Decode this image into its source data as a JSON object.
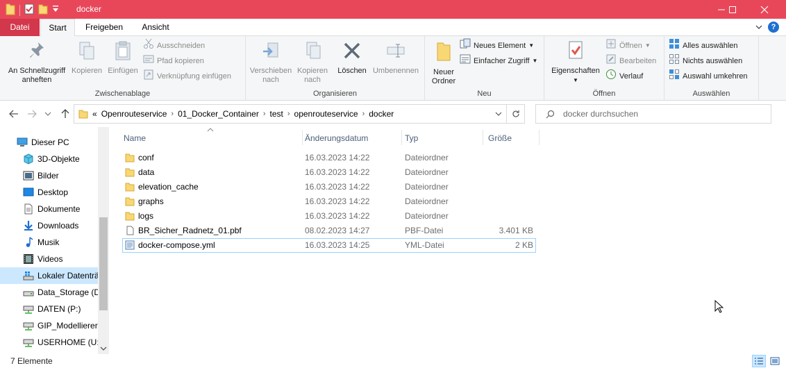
{
  "window": {
    "title": "docker",
    "accent": "#e8475a"
  },
  "tabs": {
    "file": "Datei",
    "start": "Start",
    "share": "Freigeben",
    "view": "Ansicht"
  },
  "ribbon": {
    "clipboard": {
      "label": "Zwischenablage",
      "pin": "An Schnellzugriff anheften",
      "copy": "Kopieren",
      "paste": "Einfügen",
      "cut": "Ausschneiden",
      "copy_path": "Pfad kopieren",
      "paste_shortcut": "Verknüpfung einfügen"
    },
    "organize": {
      "label": "Organisieren",
      "move_to": "Verschieben nach",
      "copy_to": "Kopieren nach",
      "delete": "Löschen",
      "rename": "Umbenennen"
    },
    "new": {
      "label": "Neu",
      "new_folder": "Neuer Ordner",
      "new_item": "Neues Element",
      "easy_access": "Einfacher Zugriff"
    },
    "open": {
      "label": "Öffnen",
      "properties": "Eigenschaften",
      "open": "Öffnen",
      "edit": "Bearbeiten",
      "history": "Verlauf"
    },
    "select": {
      "label": "Auswählen",
      "select_all": "Alles auswählen",
      "select_none": "Nichts auswählen",
      "invert": "Auswahl umkehren"
    }
  },
  "address": {
    "overflow": "«",
    "crumbs": [
      "Openrouteservice",
      "01_Docker_Container",
      "test",
      "openrouteservice",
      "docker"
    ],
    "search_placeholder": "docker durchsuchen"
  },
  "nav": {
    "items": [
      {
        "label": "Dieser PC",
        "icon": "pc-icon"
      },
      {
        "label": "3D-Objekte",
        "icon": "3d-objects-icon"
      },
      {
        "label": "Bilder",
        "icon": "pictures-icon"
      },
      {
        "label": "Desktop",
        "icon": "desktop-icon"
      },
      {
        "label": "Dokumente",
        "icon": "documents-icon"
      },
      {
        "label": "Downloads",
        "icon": "downloads-icon"
      },
      {
        "label": "Musik",
        "icon": "music-icon"
      },
      {
        "label": "Videos",
        "icon": "videos-icon"
      },
      {
        "label": "Lokaler Datenträ",
        "icon": "local-drive-icon"
      },
      {
        "label": "Data_Storage (D:",
        "icon": "drive-icon"
      },
      {
        "label": "DATEN (P:)",
        "icon": "network-drive-icon"
      },
      {
        "label": "GIP_Modellierer",
        "icon": "network-drive-icon"
      },
      {
        "label": "USERHOME (U:)",
        "icon": "network-drive-icon"
      }
    ]
  },
  "columns": {
    "name": "Name",
    "date": "Änderungsdatum",
    "type": "Typ",
    "size": "Größe"
  },
  "files": [
    {
      "name": "conf",
      "date": "16.03.2023 14:22",
      "type": "Dateiordner",
      "size": "",
      "icon": "folder-icon"
    },
    {
      "name": "data",
      "date": "16.03.2023 14:22",
      "type": "Dateiordner",
      "size": "",
      "icon": "folder-icon"
    },
    {
      "name": "elevation_cache",
      "date": "16.03.2023 14:22",
      "type": "Dateiordner",
      "size": "",
      "icon": "folder-icon"
    },
    {
      "name": "graphs",
      "date": "16.03.2023 14:22",
      "type": "Dateiordner",
      "size": "",
      "icon": "folder-icon"
    },
    {
      "name": "logs",
      "date": "16.03.2023 14:22",
      "type": "Dateiordner",
      "size": "",
      "icon": "folder-icon"
    },
    {
      "name": "BR_Sicher_Radnetz_01.pbf",
      "date": "08.02.2023 14:27",
      "type": "PBF-Datei",
      "size": "3.401 KB",
      "icon": "file-icon"
    },
    {
      "name": "docker-compose.yml",
      "date": "16.03.2023 14:25",
      "type": "YML-Datei",
      "size": "2 KB",
      "icon": "yml-file-icon"
    }
  ],
  "status": {
    "count": "7 Elemente"
  }
}
